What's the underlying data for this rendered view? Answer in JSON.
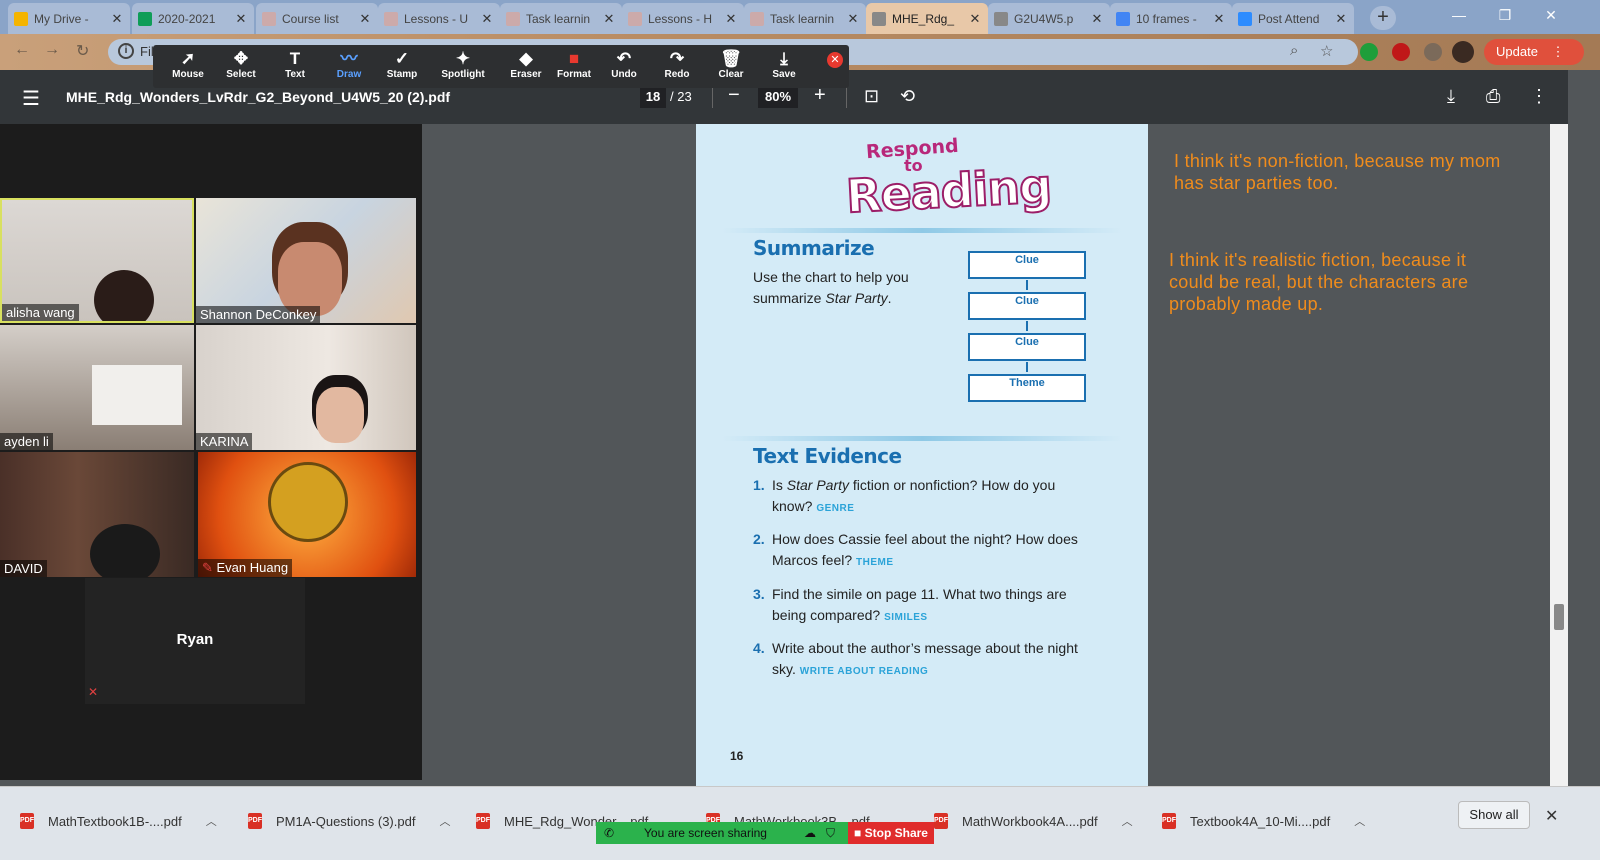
{
  "tabs": [
    {
      "label": "My Drive -",
      "icon": "drive-icon",
      "color": "#f4b400"
    },
    {
      "label": "2020-2021",
      "icon": "sheets-icon",
      "color": "#0f9d58"
    },
    {
      "label": "Course list",
      "icon": "lesson-icon",
      "color": "#caa"
    },
    {
      "label": "Lessons - U",
      "icon": "lesson-icon",
      "color": "#caa"
    },
    {
      "label": "Task learnin",
      "icon": "lesson-icon",
      "color": "#caa"
    },
    {
      "label": "Lessons - H",
      "icon": "lesson-icon",
      "color": "#caa"
    },
    {
      "label": "Task learnin",
      "icon": "lesson-icon",
      "color": "#caa"
    },
    {
      "label": "MHE_Rdg_",
      "icon": "globe-icon",
      "color": "#888"
    },
    {
      "label": "G2U4W5.p",
      "icon": "globe-icon",
      "color": "#888"
    },
    {
      "label": "10 frames -",
      "icon": "docs-icon",
      "color": "#4285f4"
    },
    {
      "label": "Post Attend",
      "icon": "zoom-icon",
      "color": "#2d8cff"
    }
  ],
  "address": {
    "text": "Fil"
  },
  "update_label": "Update",
  "annot_tools": [
    {
      "label": "Mouse",
      "icon": "cursor-icon",
      "glyph": "➚"
    },
    {
      "label": "Select",
      "icon": "move-icon",
      "glyph": "✥"
    },
    {
      "label": "Text",
      "icon": "text-icon",
      "glyph": "T"
    },
    {
      "label": "Draw",
      "icon": "draw-icon",
      "glyph": "〰"
    },
    {
      "label": "Stamp",
      "icon": "check-icon",
      "glyph": "✓"
    },
    {
      "label": "Spotlight",
      "icon": "wand-icon",
      "glyph": "✦"
    },
    {
      "label": "Eraser",
      "icon": "eraser-icon",
      "glyph": "◆"
    },
    {
      "label": "Format",
      "icon": "format-icon",
      "glyph": "■"
    },
    {
      "label": "Undo",
      "icon": "undo-icon",
      "glyph": "↶"
    },
    {
      "label": "Redo",
      "icon": "redo-icon",
      "glyph": "↷"
    },
    {
      "label": "Clear",
      "icon": "trash-icon",
      "glyph": "🗑"
    },
    {
      "label": "Save",
      "icon": "save-icon",
      "glyph": "⤓"
    }
  ],
  "pdf": {
    "title": "MHE_Rdg_Wonders_LvRdr_G2_Beyond_U4W5_20 (2).pdf",
    "page": "18",
    "total": "/ 23",
    "zoom": "80%"
  },
  "participants": [
    {
      "name": "alisha wang"
    },
    {
      "name": "Shannon DeConkey"
    },
    {
      "name": "ayden li"
    },
    {
      "name": "KARINA"
    },
    {
      "name": "DAVID"
    },
    {
      "name": "Evan Huang"
    }
  ],
  "ryan": "Ryan",
  "page": {
    "banner": {
      "line1": "Respond",
      "line2": "to",
      "line3": "Reading"
    },
    "summarize": {
      "heading": "Summarize",
      "text_a": "Use the chart to help you summarize ",
      "text_b": "Star Party",
      "text_c": "."
    },
    "clues": [
      "Clue",
      "Clue",
      "Clue",
      "Theme"
    ],
    "evidence_heading": "Text Evidence",
    "questions": [
      {
        "n": "1.",
        "a": "Is ",
        "i": "Star Party",
        "b": " fiction or nonfiction? How do you know? ",
        "tag": "GENRE"
      },
      {
        "n": "2.",
        "a": "How does Cassie feel about the night? How does Marcos feel? ",
        "i": "",
        "b": "",
        "tag": "THEME"
      },
      {
        "n": "3.",
        "a": "Find the simile on page 11. What two things are being compared? ",
        "i": "",
        "b": "",
        "tag": "SIMILES"
      },
      {
        "n": "4.",
        "a": "Write about the author’s message about the night sky. ",
        "i": "",
        "b": "",
        "tag": "WRITE ABOUT READING"
      }
    ],
    "page_number": "16"
  },
  "notes": [
    "I think it's non-fiction, because my mom has star parties too.",
    "I think it's realistic fiction, because it could be real, but the characters are probably made up."
  ],
  "downloads": [
    "MathTextbook1B-....pdf",
    "PM1A-Questions (3).pdf",
    "MHE_Rdg_Wonder....pdf",
    "MathWorkbook3B....pdf",
    "MathWorkbook4A....pdf",
    "Textbook4A_10-Mi....pdf"
  ],
  "show_all": "Show all",
  "sharing": {
    "status": "You are screen sharing",
    "stop": "Stop Share"
  },
  "colors": {
    "accent": "#1a6fb0",
    "note": "#f08c1c",
    "stop": "#e02c2c",
    "share": "#2bb24c"
  }
}
